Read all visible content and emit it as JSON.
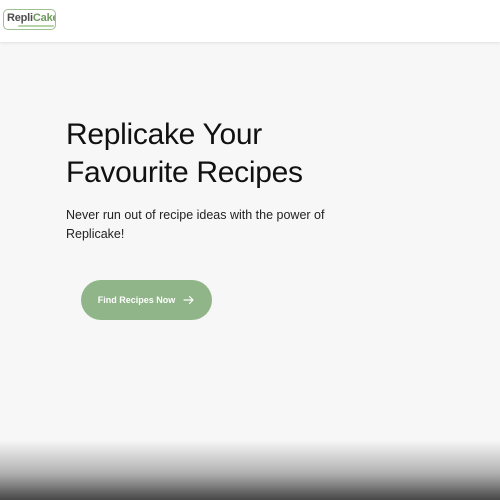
{
  "header": {
    "logo": {
      "part1": "Repli",
      "part2": "Cake"
    }
  },
  "hero": {
    "title": "Replicake Your Favourite Recipes",
    "subtitle": "Never run out of recipe ideas with the power of Replicake!",
    "cta_label": "Find Recipes Now"
  },
  "icons": {
    "cta": "arrow-right-icon"
  },
  "colors": {
    "brand_green": "#8fb588",
    "logo_green": "#6f9a5e",
    "background": "#f7f7f7"
  }
}
